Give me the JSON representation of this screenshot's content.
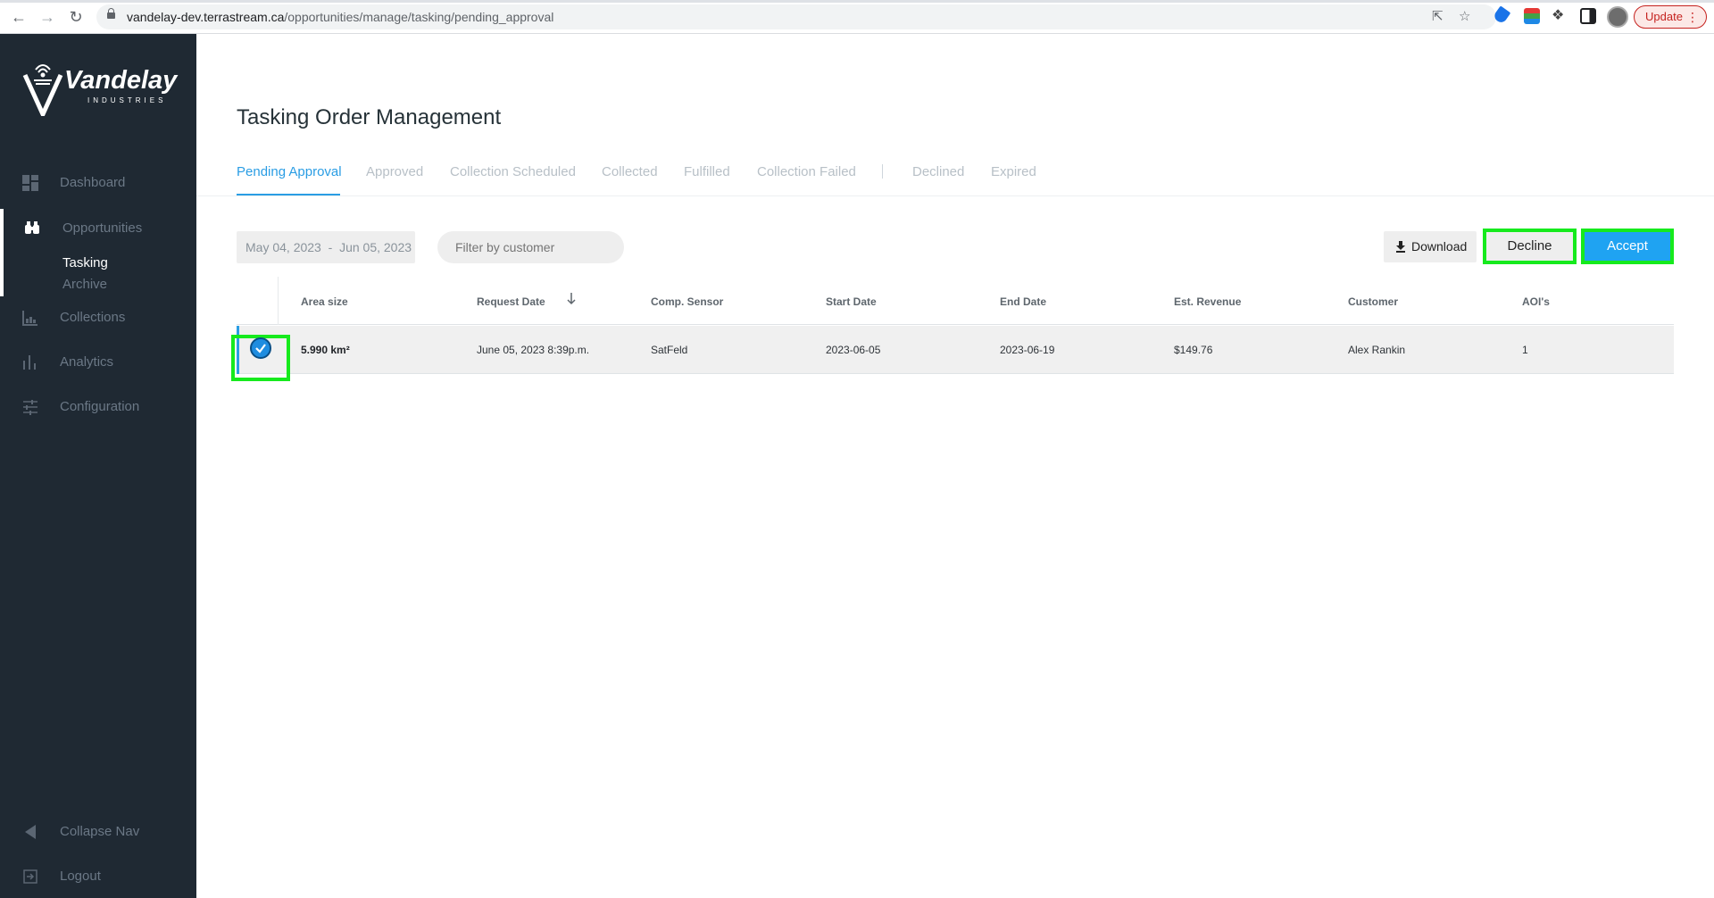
{
  "browser": {
    "url_host": "vandelay-dev.terrastream.ca",
    "url_path": "/opportunities/manage/tasking/pending_approval",
    "update_label": "Update"
  },
  "brand": {
    "name": "Vandelay",
    "subtitle": "INDUSTRIES"
  },
  "sidebar": {
    "items": [
      {
        "label": "Dashboard",
        "icon": "dashboard-icon"
      },
      {
        "label": "Opportunities",
        "icon": "binoculars-icon"
      },
      {
        "label": "Collections",
        "icon": "collections-icon"
      },
      {
        "label": "Analytics",
        "icon": "bar-chart-icon"
      },
      {
        "label": "Configuration",
        "icon": "sliders-icon"
      }
    ],
    "subitems": [
      {
        "label": "Tasking",
        "active": true
      },
      {
        "label": "Archive",
        "active": false
      }
    ],
    "collapse_label": "Collapse Nav",
    "logout_label": "Logout"
  },
  "page": {
    "title": "Tasking Order Management",
    "tabs": [
      {
        "label": "Pending Approval",
        "active": true
      },
      {
        "label": "Approved"
      },
      {
        "label": "Collection Scheduled"
      },
      {
        "label": "Collected"
      },
      {
        "label": "Fulfilled"
      },
      {
        "label": "Collection Failed"
      },
      {
        "label": "Declined"
      },
      {
        "label": "Expired"
      }
    ]
  },
  "toolbar": {
    "date_from": "May 04, 2023",
    "date_sep": "-",
    "date_to": "Jun 05, 2023",
    "filter_placeholder": "Filter by customer",
    "download_label": "Download",
    "decline_label": "Decline",
    "accept_label": "Accept"
  },
  "table": {
    "columns": [
      "Area size",
      "Request Date",
      "Comp. Sensor",
      "Start Date",
      "End Date",
      "Est. Revenue",
      "Customer",
      "AOI's"
    ],
    "rows": [
      {
        "selected": true,
        "area_size": "5.990 km²",
        "request_date": "June 05, 2023 8:39p.m.",
        "sensor": "SatFeld",
        "start_date": "2023-06-05",
        "end_date": "2023-06-19",
        "revenue": "$149.76",
        "customer": "Alex Rankin",
        "aois": "1"
      }
    ]
  },
  "colors": {
    "sidebar_bg": "#1f2933",
    "accent": "#2a9de4",
    "accept_bg": "#1fa3f2",
    "highlight": "#16ea1d"
  }
}
